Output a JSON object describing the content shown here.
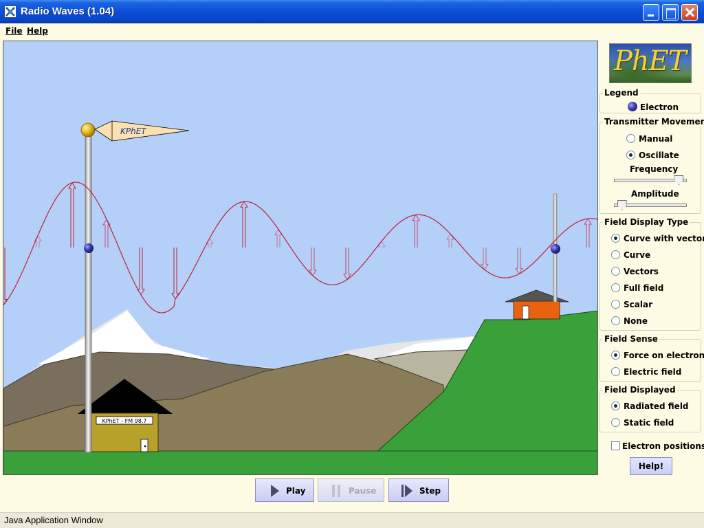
{
  "window": {
    "title": "Radio Waves (1.04)"
  },
  "menu": {
    "file": "File",
    "help": "Help"
  },
  "scene": {
    "flag_text": "KPhET",
    "station_sign": "KPhET - FM 98.7",
    "colors": {
      "sky": "#b4cff8",
      "wave": "#c0203a",
      "grass": "#3aa03a",
      "house_roof": "#555555",
      "house_wall": "#e8620f"
    }
  },
  "panel": {
    "logo_text": "PhET",
    "legend": {
      "title": "Legend",
      "electron_label": "Electron"
    },
    "transmitter": {
      "title": "Transmitter Movement",
      "manual": "Manual",
      "oscillate": "Oscillate",
      "selected": "Oscillate",
      "frequency_label": "Frequency",
      "frequency_level": 0.95,
      "amplitude_label": "Amplitude",
      "amplitude_level": 0.05
    },
    "display_type": {
      "title": "Field Display Type",
      "options": [
        "Curve with vectors",
        "Curve",
        "Vectors",
        "Full field",
        "Scalar",
        "None"
      ],
      "selected": "Curve with vectors"
    },
    "field_sense": {
      "title": "Field Sense",
      "options": [
        "Force on electron",
        "Electric field"
      ],
      "selected": "Force on electron"
    },
    "field_displayed": {
      "title": "Field Displayed",
      "options": [
        "Radiated field",
        "Static field"
      ],
      "selected": "Radiated field"
    },
    "electron_positions_label": "Electron positions",
    "electron_positions_checked": false,
    "help_button": "Help!"
  },
  "controls": {
    "play": "Play",
    "pause": "Pause",
    "step": "Step"
  },
  "status": {
    "text": "Java Application Window"
  }
}
